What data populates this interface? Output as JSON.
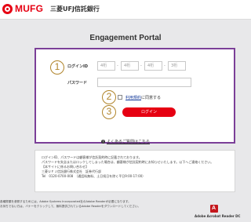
{
  "header": {
    "brand": "MUFG",
    "bank_name": "三菱UFJ信託銀行"
  },
  "portal_title": "Engagement Portal",
  "form": {
    "login_id_label": "ログインID",
    "login_id_segments": [
      "4桁",
      "4桁",
      "4桁",
      "3桁"
    ],
    "password_label": "パスワード",
    "password_value": "",
    "terms_link": "利用規約",
    "terms_suffix": "に同意する",
    "terms_checked": false,
    "login_button": "ログイン",
    "step_badges": [
      "1",
      "2",
      "3"
    ]
  },
  "help_link": "よくあるご質問はこちら",
  "info_lines": [
    "ログインID、パスワードは顧客様が信託契約時に記載されております。",
    "パスワードを失念またはロックしてしまった場合は、顧客様が信託契約時にお知らせいたします。以下へご連絡ください。",
    "【本サイトに係るお問い合わせ】",
    "三菱ＵＦＪ信託銀行株式会社　証券代行部",
    "Tel　0120-0700-008　（通話料無料、土日祝日を除く平日9:00-17:00）"
  ],
  "notice_lines": [
    "各種書類を参照するためには、Adobe Systems Incorporated社のAdobe Readerが必要になります。",
    "お持ちでない方は、バナーをクリックして、無料提供されているAdobe Readerをダウンロードしてください。"
  ],
  "adobe_label": "Adobe Acrobat Reader DC",
  "colors": {
    "brand_red": "#e60012",
    "panel_border": "#7b3f98",
    "badge_gold": "#b0842a"
  }
}
